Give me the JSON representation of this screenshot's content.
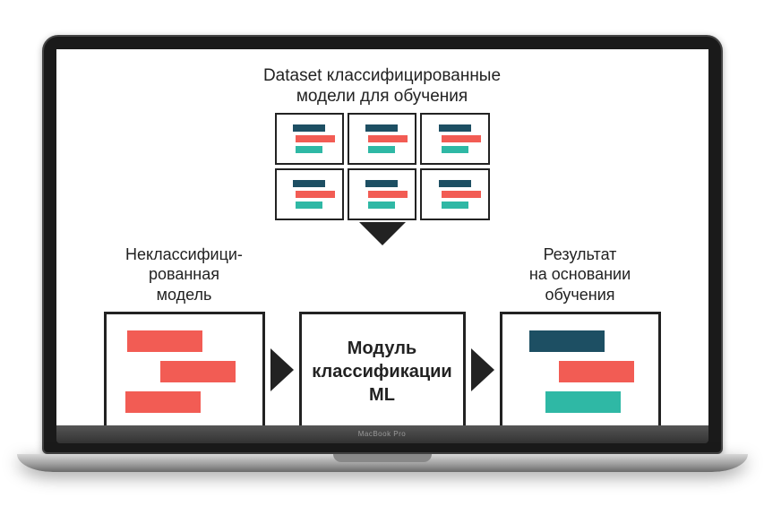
{
  "device_label": "MacBook Pro",
  "dataset": {
    "title_line1": "Dataset классифицированные",
    "title_line2": "модели для обучения"
  },
  "input": {
    "label_line1": "Неклассифици-",
    "label_line2": "рованная",
    "label_line3": "модель"
  },
  "center": {
    "label_line1": "Модуль",
    "label_line2": "классификации",
    "label_line3": "ML"
  },
  "output": {
    "label_line1": "Результат",
    "label_line2": "на основании",
    "label_line3": "обучения"
  },
  "colors": {
    "navy": "#1d4f63",
    "coral": "#f25c54",
    "teal": "#2fb8a5"
  }
}
